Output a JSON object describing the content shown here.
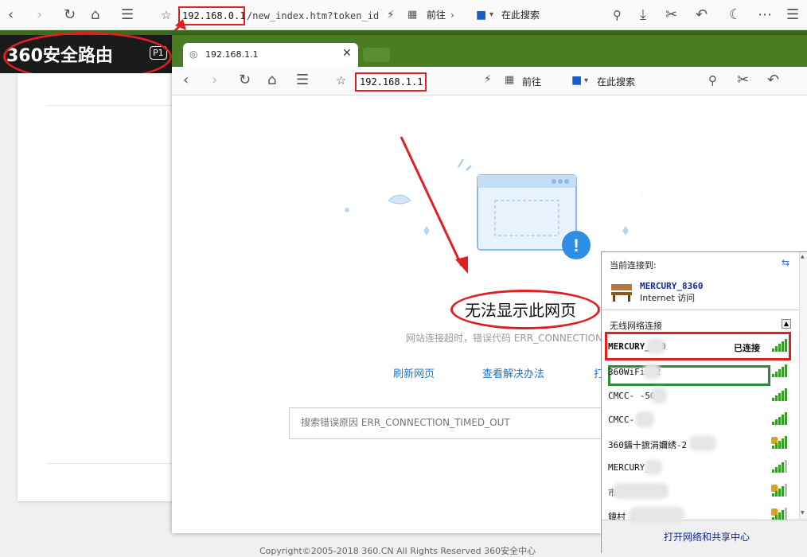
{
  "back_browser": {
    "address_highlight": "192.168.0.1",
    "address_rest": "/new_index.htm?token_id",
    "goto_label": "前往",
    "search_placeholder": "在此搜索"
  },
  "router_header": {
    "logo": "360安全路由",
    "badge": "P1"
  },
  "front_browser": {
    "tab_title": "192.168.1.1",
    "address": "192.168.1.1",
    "goto_label": "前往",
    "search_placeholder": "在此搜索"
  },
  "error_page": {
    "title": "无法显示此网页",
    "subtitle": "网站连接超时，错误代码 ERR_CONNECTION_",
    "link_refresh": "刷新网页",
    "link_solution": "查看解决办法",
    "link_more": "打",
    "search_placeholder": "搜索错误原因 ERR_CONNECTION_TIMED_OUT",
    "copyright": "Copyright©2005-2018 360.CN All Rights Reserved 360安全中心"
  },
  "wifi_panel": {
    "current_label": "当前连接到:",
    "current_name": "MERCURY_8360",
    "current_status": "Internet 访问",
    "section_label": "无线网络连接",
    "networks": [
      {
        "name": "MERCURY_   60",
        "status": "已连接",
        "bars": 4,
        "secured": false
      },
      {
        "name": "360WiFi-   2",
        "status": "",
        "bars": 4,
        "secured": false
      },
      {
        "name": "CMCC-    -5G",
        "status": "",
        "bars": 4,
        "secured": false
      },
      {
        "name": "CMCC-",
        "status": "",
        "bars": 4,
        "secured": false
      },
      {
        "name": "360鑄十摭涓嬭绣-2     8",
        "status": "",
        "bars": 4,
        "secured": true
      },
      {
        "name": "MERCURY_",
        "status": "",
        "bars": 3,
        "secured": false
      },
      {
        "name": "      市",
        "status": "",
        "bars": 3,
        "secured": true
      },
      {
        "name": "鍏村       崱底競",
        "status": "",
        "bars": 3,
        "secured": true
      }
    ],
    "open_center": "打开网络和共享中心"
  },
  "colors": {
    "accent_red": "#e02020",
    "link_blue": "#1a73c8",
    "tab_green": "#4a7c23",
    "signal_green": "#3a9a2a"
  }
}
